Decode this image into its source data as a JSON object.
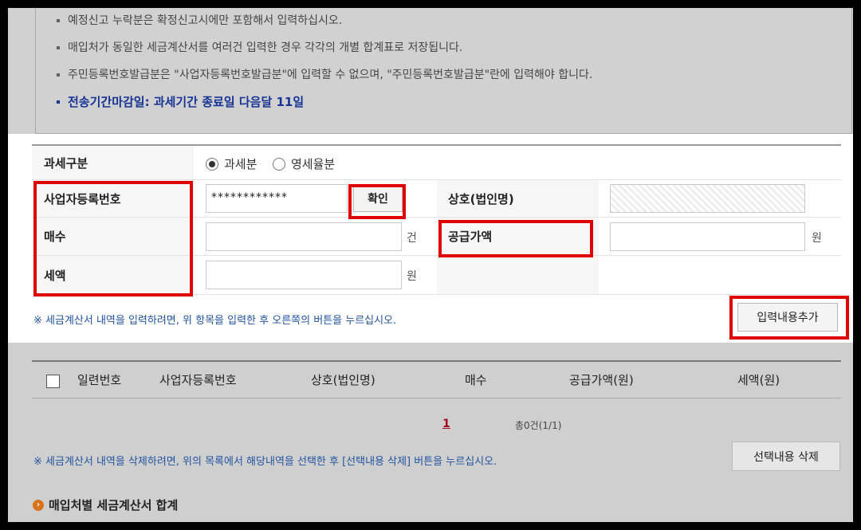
{
  "notices": [
    "예정신고 누락분은 확정신고시에만 포함해서 입력하십시오.",
    "매입처가 동일한 세금계산서를 여러건 입력한 경우 각각의 개별 합계표로 저장됩니다.",
    "주민등록번호발급분은 \"사업자등록번호발급분\"에 입력할 수 없으며, \"주민등록번호발급분\"란에 입력해야 합니다."
  ],
  "deadline": "전송기간마감일: 과세기간 종료일 다음달 11일",
  "form": {
    "tax_type_label": "과세구분",
    "tax_options": [
      "과세분",
      "영세율분"
    ],
    "bizno_label": "사업자등록번호",
    "bizno_value": "************",
    "confirm_button": "확인",
    "company_label": "상호(법인명)",
    "count_label": "매수",
    "count_unit": "건",
    "supply_label": "공급가액",
    "supply_unit": "원",
    "tax_label": "세액",
    "tax_unit": "원",
    "hint": "※ 세금계산서 내역을 입력하려면, 위 항목을 입력한 후 오른쪽의 버튼을 누르십시오.",
    "add_button": "입력내용추가"
  },
  "table": {
    "headers": [
      "일련번호",
      "사업자등록번호",
      "상호(법인명)",
      "매수",
      "공급가액(원)",
      "세액(원)"
    ],
    "page": "1",
    "total": "총0건(1/1)",
    "delete_hint": "※ 세금계산서 내역을 삭제하려면, 위의 목록에서 해당내역을 선택한 후 [선택내용 삭제] 버튼을 누르십시오.",
    "delete_button": "선택내용 삭제"
  },
  "section_title": "매입처별 세금계산서 합계",
  "colors": {
    "highlight": "#e00000",
    "deadline": "#1d3fb5",
    "hint": "#2253a0"
  }
}
